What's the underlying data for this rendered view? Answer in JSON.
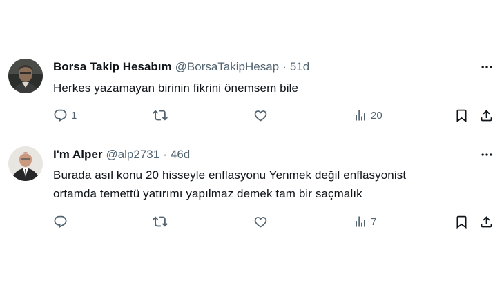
{
  "tweets": [
    {
      "display_name": "Borsa Takip Hesabım",
      "handle": "@BorsaTakipHesap",
      "separator": "·",
      "age": "51d",
      "text_lines": [
        "Herkes yazamayan birinin fikrini önemsem bile"
      ],
      "counts": {
        "replies": "1",
        "retweets": "",
        "likes": "",
        "views": "20"
      },
      "icons": {
        "more": "more-horizontal-icon",
        "reply": "reply-icon",
        "retweet": "retweet-icon",
        "like": "heart-icon",
        "views": "views-icon",
        "bookmark": "bookmark-icon",
        "share": "share-icon"
      }
    },
    {
      "display_name": "I'm Alper",
      "handle": "@alp2731",
      "separator": "·",
      "age": "46d",
      "text_lines": [
        "Burada asıl konu 20 hisseyle enflasyonu Yenmek değil enflasyonist",
        "ortamda temettü yatırımı yapılmaz demek tam bir saçmalık"
      ],
      "counts": {
        "replies": "",
        "retweets": "",
        "likes": "",
        "views": "7"
      },
      "icons": {
        "more": "more-horizontal-icon",
        "reply": "reply-icon",
        "retweet": "retweet-icon",
        "like": "heart-icon",
        "views": "views-icon",
        "bookmark": "bookmark-icon",
        "share": "share-icon"
      }
    }
  ],
  "colors": {
    "text_primary": "#0f1419",
    "text_secondary": "#536471",
    "divider": "#eff3f4"
  }
}
